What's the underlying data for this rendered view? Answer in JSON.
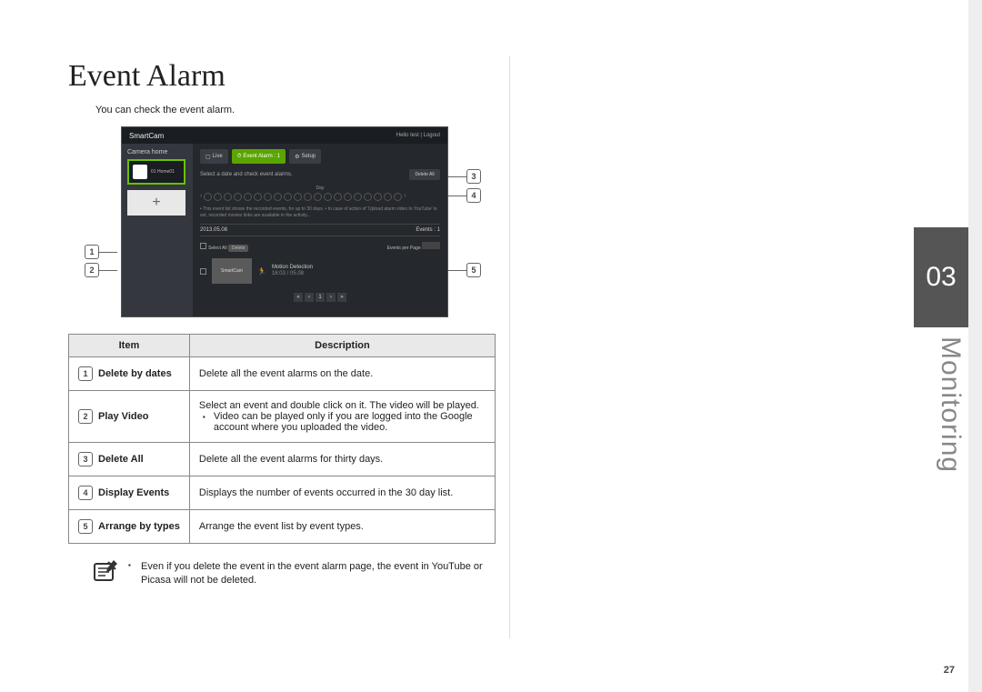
{
  "section": {
    "number": "03",
    "label": "Monitoring"
  },
  "page_number": "27",
  "heading": "Event Alarm",
  "intro": "You can check the event alarm.",
  "screenshot": {
    "brand": "SmartCam",
    "header_links": "Hello test  |  Logout",
    "side_title": "Camera home",
    "thumb_name": "01  Home01",
    "add_camera": "+",
    "tab_live": "Live",
    "tab_event": "Event Alarm : 1",
    "tab_setup": "Setup",
    "subtitle": "Select a date and check event alarms.",
    "delete_all_btn": "Delete All",
    "day_label": "Day",
    "notes": "• This event list shows the recorded events, for up to 30 days.\n• In case of action of 'Upload alarm video to YouTube' is set, recorded movies links are available in the activity...",
    "date_label": "2013.05.08",
    "events_label": "Events : 1",
    "select_all": "Select All",
    "delete_btn": "Delete",
    "per_page": "Events per Page",
    "event_thumb": "SmartCam",
    "event_title": "Motion Detection",
    "event_time": "16:03 / 05.08"
  },
  "table": {
    "header_item": "Item",
    "header_desc": "Description",
    "rows": [
      {
        "num": "1",
        "name": "Delete by dates",
        "desc": "Delete all the event alarms on the date."
      },
      {
        "num": "2",
        "name": "Play Video",
        "desc": "Select an event and double click on it. The video will be played.",
        "bullet": "Video can be played only if you are logged into the Google account where you uploaded the video."
      },
      {
        "num": "3",
        "name": "Delete All",
        "desc": "Delete all the event alarms for thirty days."
      },
      {
        "num": "4",
        "name": "Display Events",
        "desc": "Displays the number of events occurred in the 30 day list."
      },
      {
        "num": "5",
        "name": "Arrange by types",
        "desc": "Arrange the event list by event types."
      }
    ]
  },
  "note": "Even if you delete the event in the event alarm page, the event in YouTube or Picasa will not be deleted."
}
